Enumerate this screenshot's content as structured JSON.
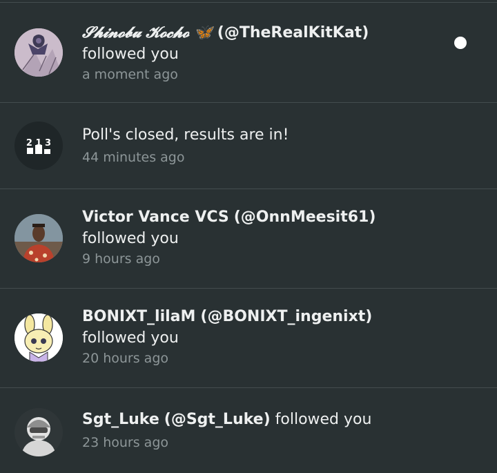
{
  "notifications": [
    {
      "display_name": "𝓢𝓱𝓲𝓷𝓸𝓫𝓾 𝓚𝓸𝓬𝓱𝓸 🦋",
      "handle": "(@TheRealKitKat)",
      "action": "followed you",
      "time": "a moment ago",
      "unread": true
    },
    {
      "message": "Poll's closed, results are in!",
      "time": "44 minutes ago",
      "icon": "poll-results-icon",
      "icon_text": "2 1 3"
    },
    {
      "display_name": "Victor Vance VCS",
      "handle": "(@OnnMeesit61)",
      "action": "followed you",
      "time": "9 hours ago"
    },
    {
      "display_name": "BONIXT_lilaM",
      "handle": "(@BONIXT_ingenixt)",
      "action": "followed you",
      "time": "20 hours ago"
    },
    {
      "display_name": "Sgt_Luke",
      "handle": "(@Sgt_Luke)",
      "action": "followed you",
      "time": "23 hours ago"
    }
  ],
  "colors": {
    "background": "#293133",
    "divider": "#444d4f",
    "primary_text": "#eef0f0",
    "secondary_text": "#8d9698",
    "unread_dot": "#ffffff"
  }
}
